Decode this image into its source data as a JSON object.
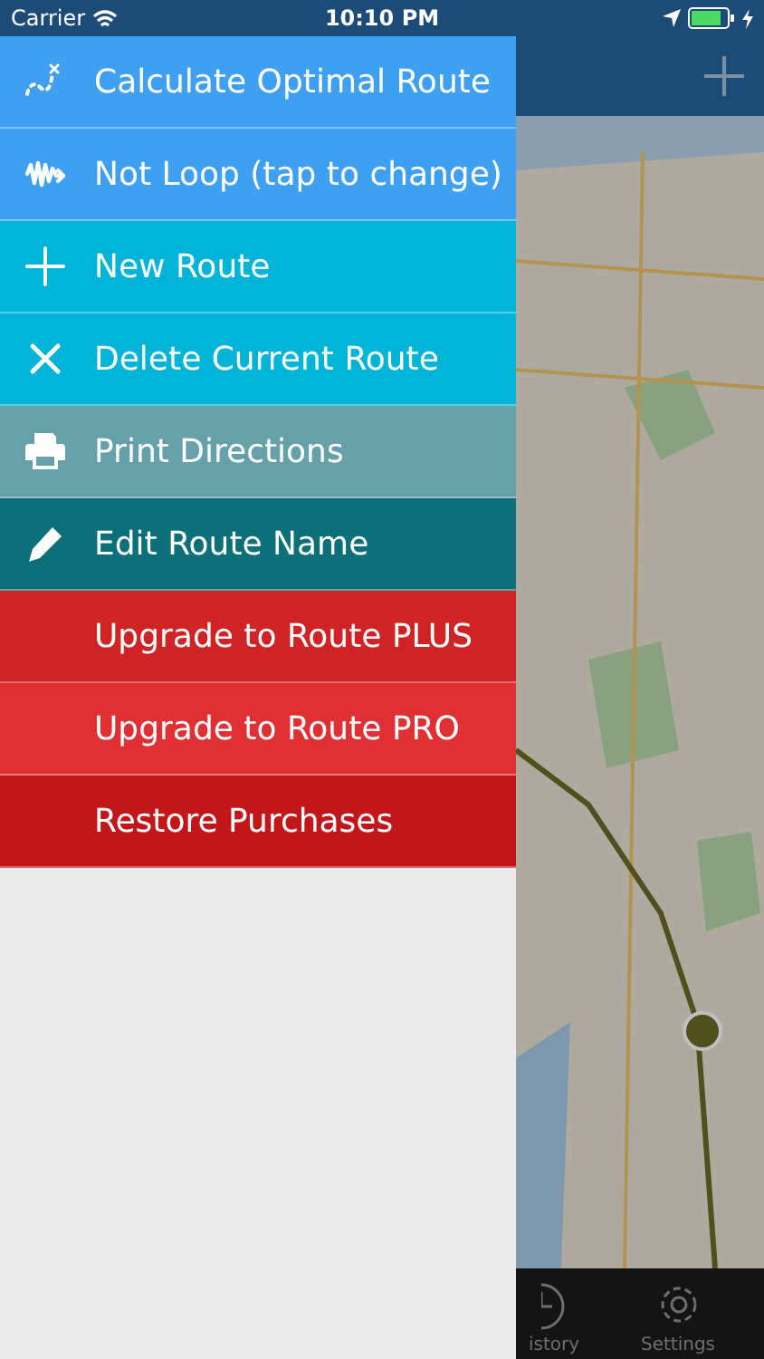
{
  "status_bar": {
    "carrier": "Carrier",
    "time": "10:10 PM"
  },
  "menu": [
    {
      "kind": "route",
      "label": "Calculate Optimal Route",
      "color": "#3fa0f2"
    },
    {
      "kind": "loop",
      "label": "Not Loop (tap to change)",
      "color": "#3fa0f2"
    },
    {
      "kind": "add",
      "label": "New Route",
      "color": "#00b4d8"
    },
    {
      "kind": "delete",
      "label": "Delete Current Route",
      "color": "#00b4d8"
    },
    {
      "kind": "print",
      "label": "Print Directions",
      "color": "#66a0a8"
    },
    {
      "kind": "edit",
      "label": "Edit Route Name",
      "color": "#0d6f78"
    },
    {
      "kind": "text",
      "label": "Upgrade to Route PLUS",
      "color": "#cf2326"
    },
    {
      "kind": "text",
      "label": "Upgrade to Route PRO",
      "color": "#e03034"
    },
    {
      "kind": "text",
      "label": "Restore Purchases",
      "color": "#c3161a"
    }
  ],
  "tab_bar": [
    {
      "kind": "history",
      "label": "istory"
    },
    {
      "kind": "settings",
      "label": "Settings"
    }
  ]
}
